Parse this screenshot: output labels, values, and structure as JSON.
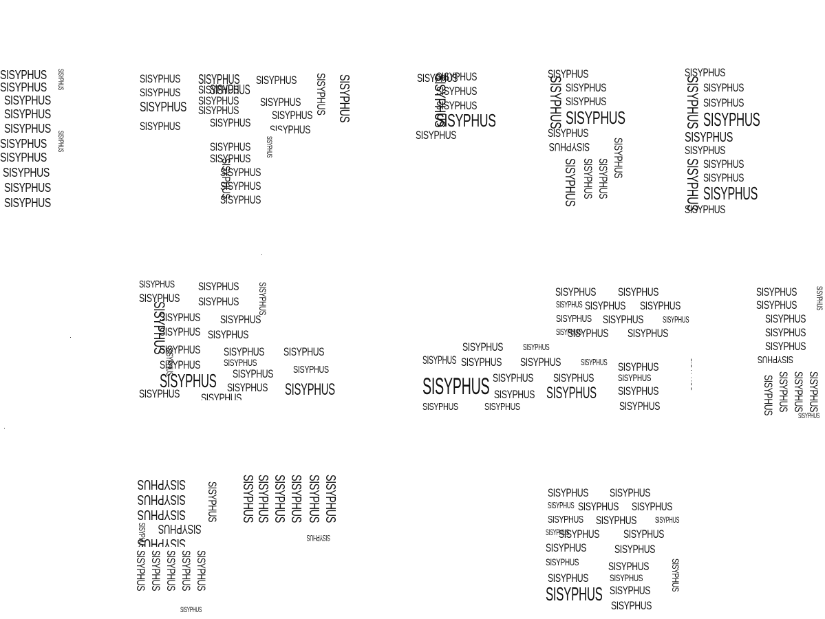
{
  "word": "SISYPHUS",
  "colors": {
    "background": "#ffffff",
    "text": "#111111"
  },
  "blocks": [
    {
      "name": "block-top-far-left-column",
      "shape": "column"
    },
    {
      "name": "block-top-left-t-shape",
      "shape": "t-shape"
    },
    {
      "name": "block-top-center-small",
      "shape": "small-square"
    },
    {
      "name": "block-top-right-tall-left",
      "shape": "tall-rectangle"
    },
    {
      "name": "block-top-right-tall-right",
      "shape": "tall-rectangle"
    },
    {
      "name": "block-middle-left-square",
      "shape": "square"
    },
    {
      "name": "block-middle-center-l-shape",
      "shape": "l-shape"
    },
    {
      "name": "block-middle-far-right-column",
      "shape": "column"
    },
    {
      "name": "block-bottom-left-l-shape",
      "shape": "l-shape"
    },
    {
      "name": "block-bottom-right-column",
      "shape": "column"
    }
  ]
}
